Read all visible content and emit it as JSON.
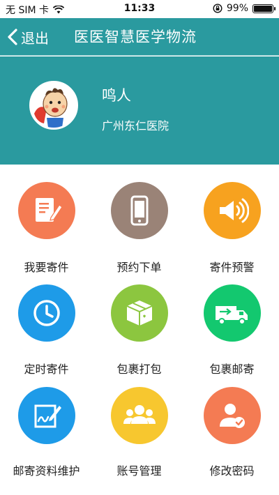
{
  "status_bar": {
    "carrier": "无 SIM 卡",
    "time": "11:33",
    "battery_percent": "99%",
    "battery_level": 0.99
  },
  "nav": {
    "back_label": "退出",
    "title": "医医智慧医学物流"
  },
  "profile": {
    "name": "鸣人",
    "organization": "广州东仁医院"
  },
  "menu": {
    "items": [
      {
        "label": "我要寄件",
        "icon": "edit-document-icon",
        "color": "#f47b53"
      },
      {
        "label": "预约下单",
        "icon": "mobile-phone-icon",
        "color": "#9a8377"
      },
      {
        "label": "寄件预警",
        "icon": "speaker-alert-icon",
        "color": "#f7a21f"
      },
      {
        "label": "定时寄件",
        "icon": "clock-icon",
        "color": "#1e9be8"
      },
      {
        "label": "包裹打包",
        "icon": "package-box-icon",
        "color": "#8cc63f"
      },
      {
        "label": "包裹邮寄",
        "icon": "delivery-truck-icon",
        "color": "#13c86f"
      },
      {
        "label": "邮寄资料维护",
        "icon": "signature-edit-icon",
        "color": "#1e9be8"
      },
      {
        "label": "账号管理",
        "icon": "user-group-icon",
        "color": "#f7c72f"
      },
      {
        "label": "修改密码",
        "icon": "user-check-icon",
        "color": "#f47b53"
      }
    ]
  },
  "colors": {
    "header": "#2a9a9f"
  }
}
